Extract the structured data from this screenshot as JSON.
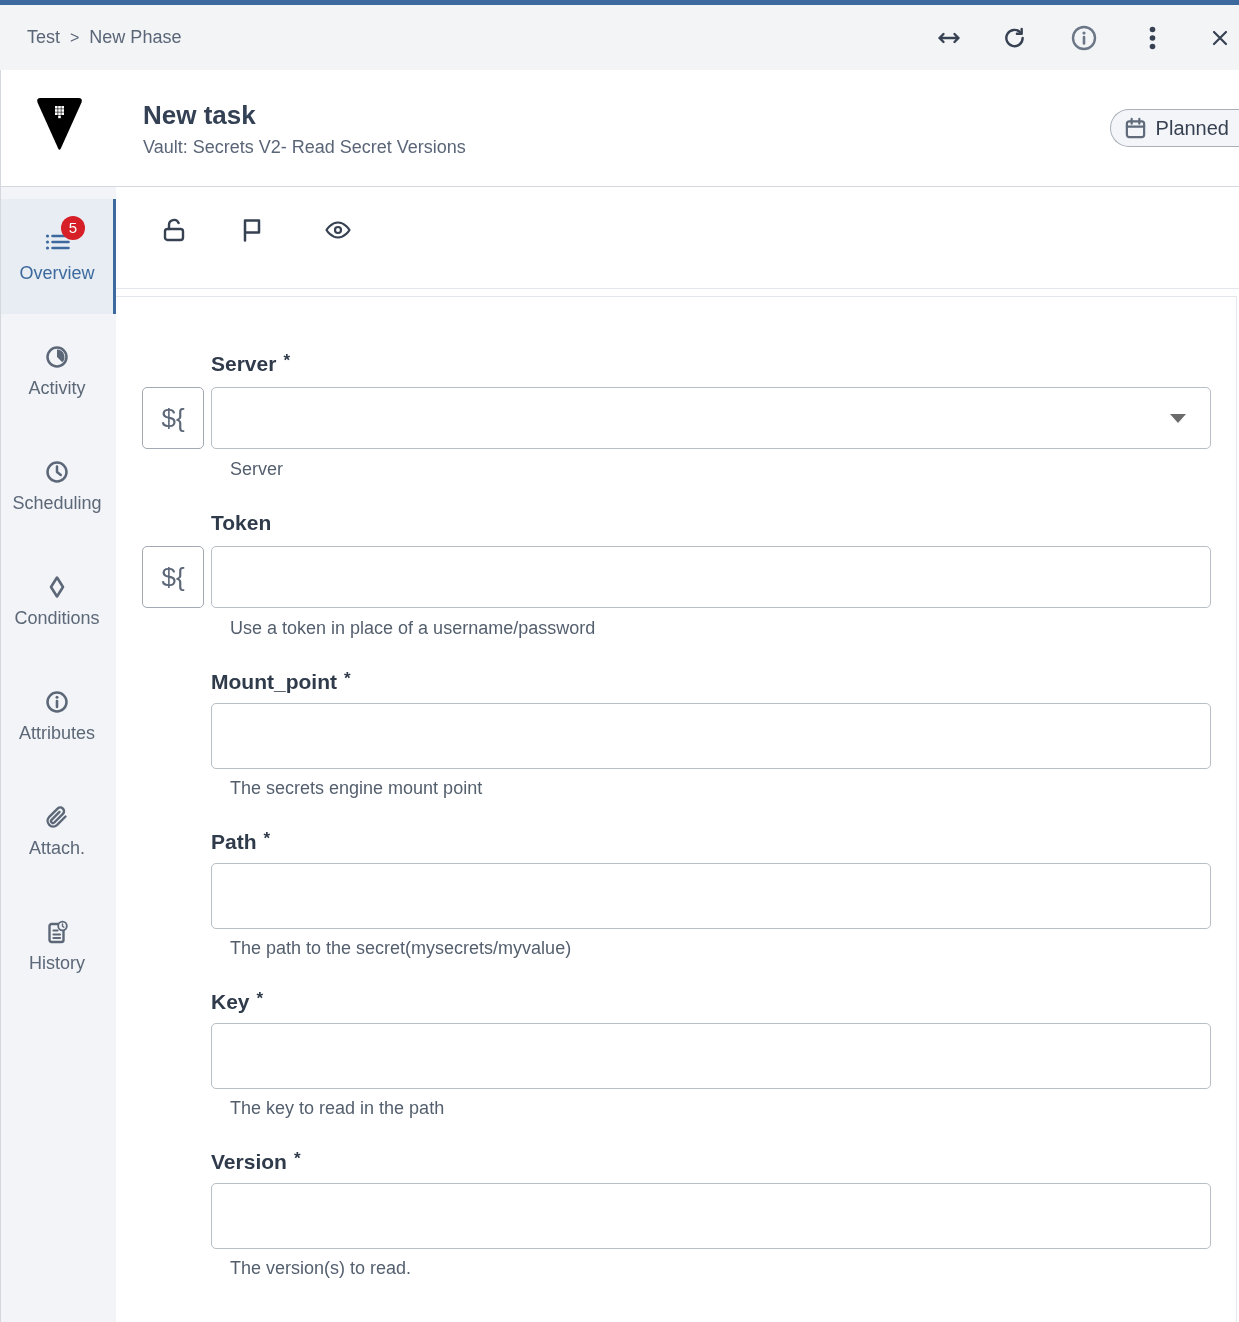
{
  "top_bar": {
    "breadcrumb": [
      {
        "label": "Test"
      },
      {
        "label": "New Phase"
      }
    ],
    "separator": ">"
  },
  "task": {
    "title": "New task",
    "subtitle": "Vault: Secrets V2- Read Secret Versions",
    "status": "Planned"
  },
  "sidebar": {
    "items": [
      {
        "label": "Overview",
        "selected": true,
        "badge": "5"
      },
      {
        "label": "Activity",
        "selected": false
      },
      {
        "label": "Scheduling",
        "selected": false
      },
      {
        "label": "Conditions",
        "selected": false
      },
      {
        "label": "Attributes",
        "selected": false
      },
      {
        "label": "Attach.",
        "selected": false
      },
      {
        "label": "History",
        "selected": false
      }
    ]
  },
  "form": {
    "fields": [
      {
        "kind": "select",
        "label": "Server",
        "required_mark": "*",
        "variable_button": "${",
        "help": "Server"
      },
      {
        "kind": "text",
        "label": "Token",
        "variable_button": "${",
        "help": "Use a token in place of a username/password"
      },
      {
        "kind": "text",
        "label": "Mount_point",
        "required_mark": "*",
        "help": "The secrets engine mount point"
      },
      {
        "kind": "text",
        "label": "Path",
        "required_mark": "*",
        "help": "The path to the secret(mysecrets/myvalue)"
      },
      {
        "kind": "text",
        "label": "Key",
        "required_mark": "*",
        "help": "The key to read in the path"
      },
      {
        "kind": "text",
        "label": "Version",
        "required_mark": "*",
        "help": "The version(s) to read."
      }
    ]
  }
}
